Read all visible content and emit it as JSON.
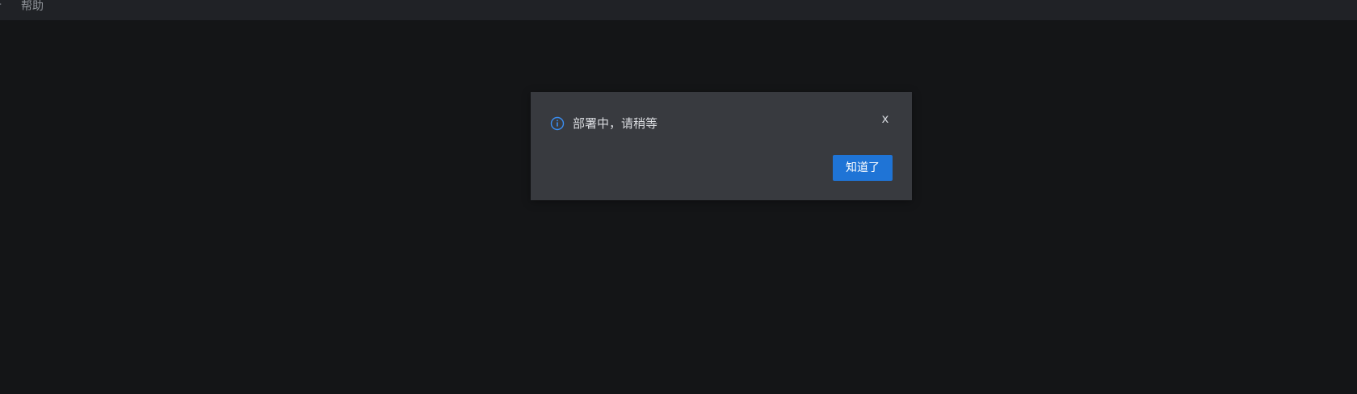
{
  "menubar": {
    "items": [
      {
        "label": "亍"
      },
      {
        "label": "帮助"
      }
    ]
  },
  "dialog": {
    "message": "部署中，请稍等",
    "close_label": "x",
    "confirm_label": "知道了",
    "icon": "info-icon"
  },
  "colors": {
    "background": "#141517",
    "menubar": "#202226",
    "dialog": "#383a3f",
    "accent": "#1f74d6",
    "info_icon": "#3a8ef2"
  }
}
